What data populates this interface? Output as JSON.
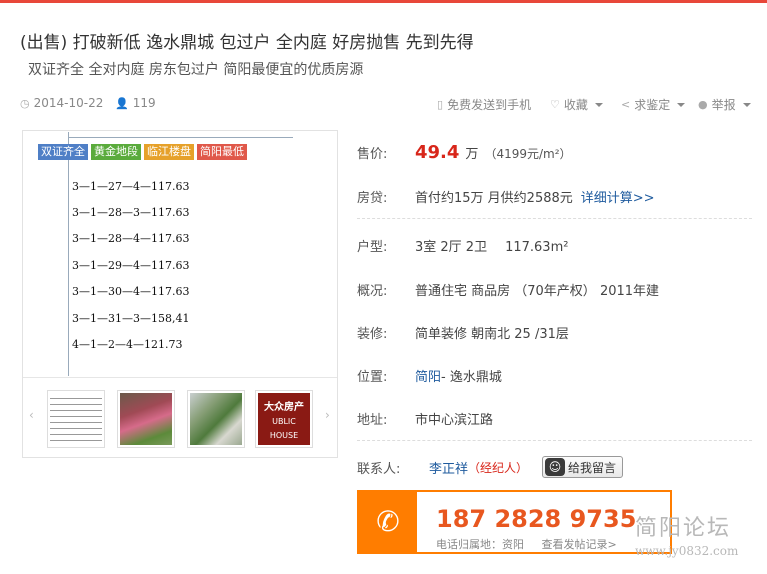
{
  "header": {
    "title": "(出售) 打破新低 逸水鼎城 包过户 全内庭 好房抛售 先到先得",
    "subtitle": "双证齐全 全对内庭 房东包过户 简阳最便宜的优质房源"
  },
  "meta": {
    "date": "2014-10-22",
    "views": "119",
    "send_to_phone": "免费发送到手机",
    "favorite": "收藏",
    "appraise": "求鉴定",
    "report": "举报"
  },
  "gallery": {
    "tags": [
      {
        "label": "双证齐全",
        "color": "#4f7fc6"
      },
      {
        "label": "黄金地段",
        "color": "#5aab3c"
      },
      {
        "label": "临江楼盘",
        "color": "#e6a12a"
      },
      {
        "label": "简阳最低",
        "color": "#e0584a"
      }
    ],
    "doc_lines": [
      "3—1—27—4—117.63",
      "3—1—28—3—117.63",
      "3—1—28—4—117.63",
      "3—1—29—4—117.63",
      "3—1—30—4—117.63",
      "3—1—31—3—158,41",
      "4—1—2—4—121.73"
    ],
    "thumb_text": "大众房产",
    "thumb_text2": "UBLIC HOUSE"
  },
  "details": {
    "price_label": "售价:",
    "price_value": "49.4",
    "price_unit": "万",
    "price_per": "（4199元/m²）",
    "loan_label": "房贷:",
    "loan_text": "首付约15万  月供约2588元",
    "loan_link": "详细计算>>",
    "layout_label": "户型:",
    "layout_value": "3室 2厅 2卫",
    "area_value": "117.63m²",
    "overview_label": "概况:",
    "overview_value": "普通住宅  商品房   （70年产权）   2011年建",
    "decor_label": "装修:",
    "decor_value": "简单装修  朝南北  25 /31层",
    "location_label": "位置:",
    "location_city": "简阳",
    "location_rest": " - 逸水鼎城",
    "address_label": "地址:",
    "address_value": "市中心滨江路",
    "contact_label": "联系人:",
    "contact_name": "李正祥",
    "contact_role": "（经纪人）",
    "message_button": "给我留言"
  },
  "phone": {
    "number": "187 2828 9735",
    "location_text": "电话归属地：资阳",
    "history_link": "查看发帖记录>"
  },
  "watermark": {
    "name": "简阳论坛",
    "url": "www.jy0832.com"
  },
  "colors": {
    "accent": "#e8473a",
    "price": "#d8261a",
    "phone_orange": "#ff7d00",
    "link": "#1f5b9e"
  }
}
